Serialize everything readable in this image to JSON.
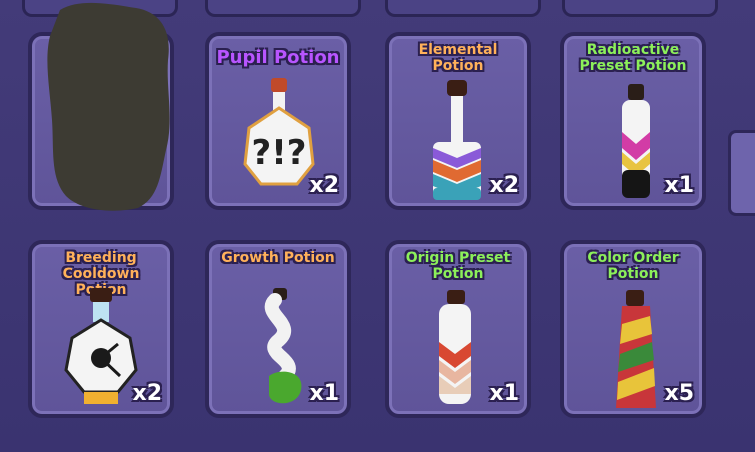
{
  "inventory": {
    "slots": [
      {
        "title": "",
        "count": "",
        "title_color": "#ffb15a",
        "icon": "hidden-potion-icon"
      },
      {
        "title": "Pupil Potion",
        "count": "x2",
        "title_color": "#b855ff",
        "icon": "pupil-potion-icon"
      },
      {
        "title": "Elemental Potion",
        "count": "x2",
        "title_color": "#ffb15a",
        "icon": "elemental-potion-icon"
      },
      {
        "title": "Radioactive Preset Potion",
        "count": "x1",
        "title_color": "#8cf05a",
        "icon": "radioactive-potion-icon"
      },
      {
        "title": "Breeding Cooldown Potion",
        "count": "x2",
        "title_color": "#ffb15a",
        "icon": "breeding-cooldown-potion-icon"
      },
      {
        "title": "Growth Potion",
        "count": "x1",
        "title_color": "#ffb15a",
        "icon": "growth-potion-icon"
      },
      {
        "title": "Origin Preset Potion",
        "count": "x1",
        "title_color": "#8cf05a",
        "icon": "origin-potion-icon"
      },
      {
        "title": "Color Order Potion",
        "count": "x5",
        "title_color": "#8cf05a",
        "icon": "color-order-potion-icon"
      }
    ]
  }
}
